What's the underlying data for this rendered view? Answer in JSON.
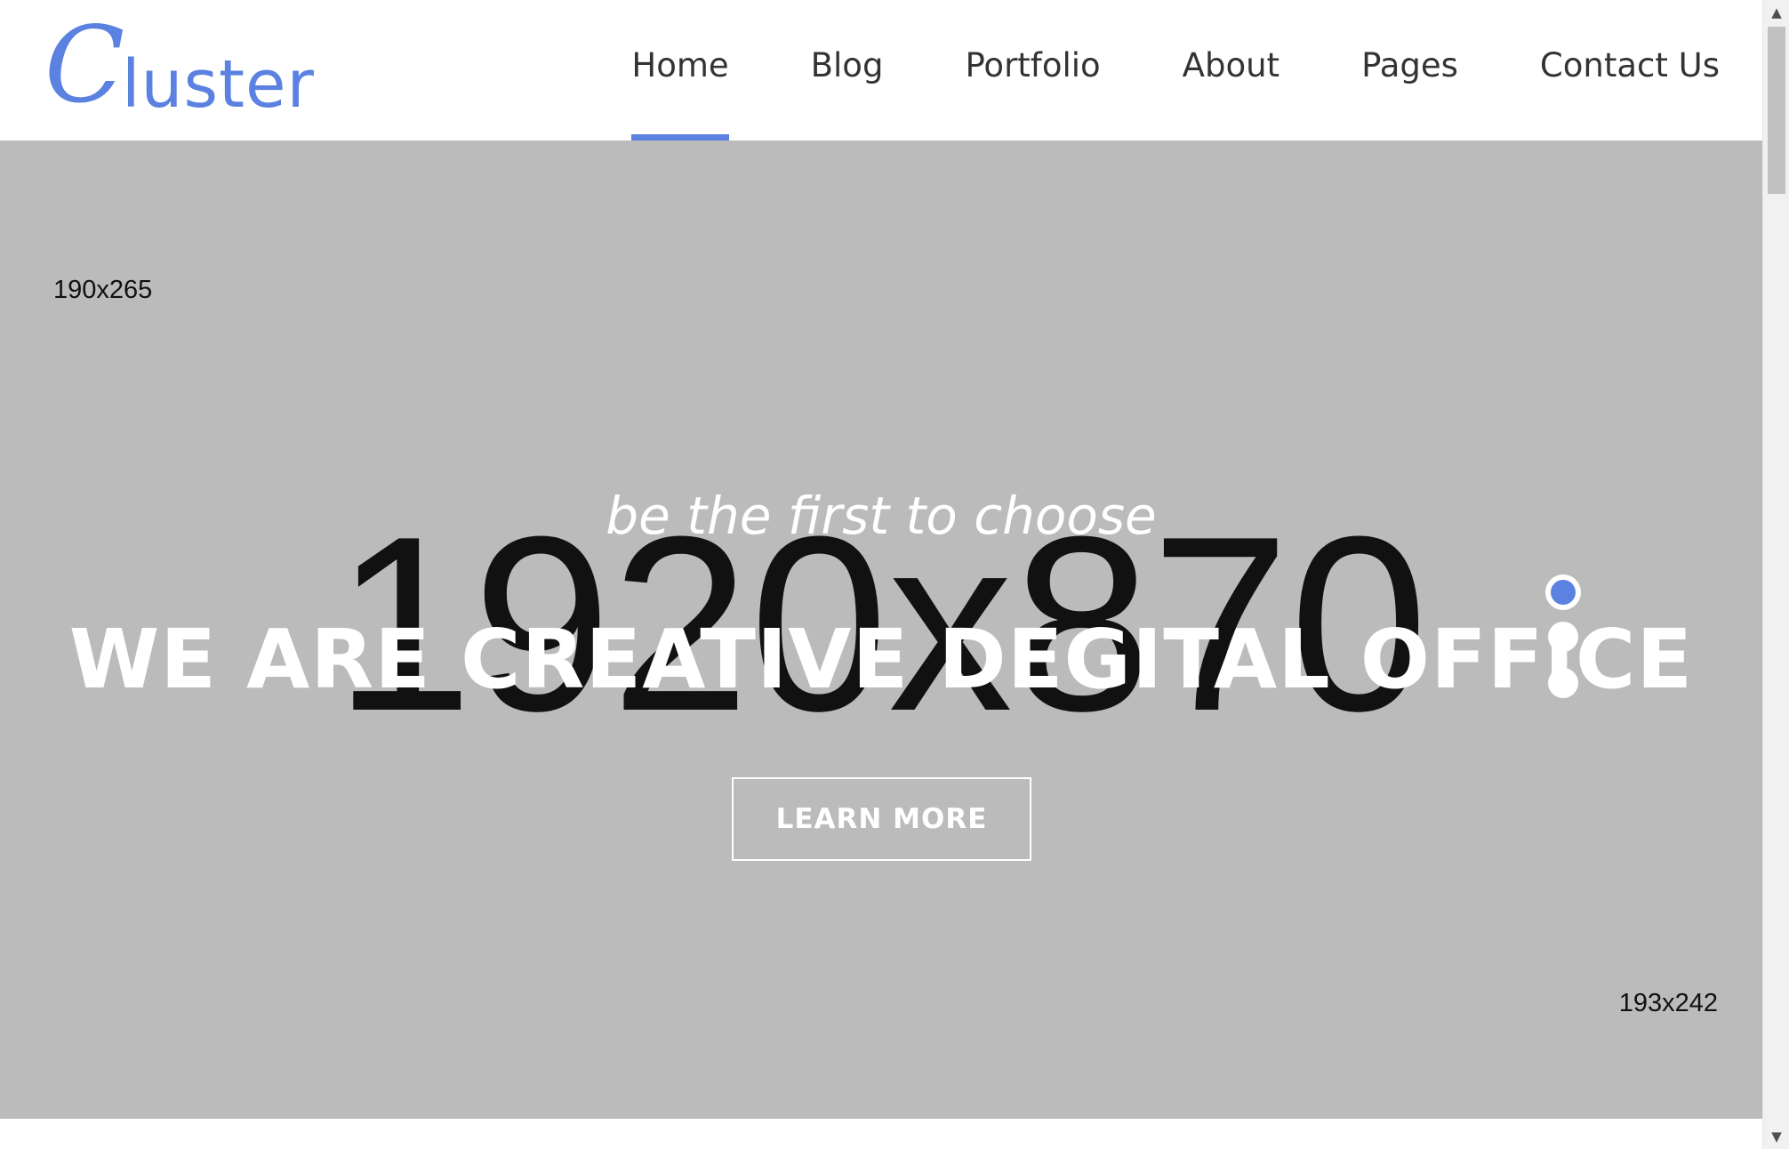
{
  "brand": {
    "logo_initial": "C",
    "logo_rest": "luster",
    "color": "#5b82e0"
  },
  "nav": {
    "items": [
      {
        "label": "Home",
        "active": true
      },
      {
        "label": "Blog",
        "active": false
      },
      {
        "label": "Portfolio",
        "active": false
      },
      {
        "label": "About",
        "active": false
      },
      {
        "label": "Pages",
        "active": false
      },
      {
        "label": "Contact Us",
        "active": false
      }
    ]
  },
  "hero": {
    "placeholder_top_left": "190x265",
    "placeholder_main": "1920x870",
    "placeholder_bottom_right": "193x242",
    "subtitle": "be the first to choose",
    "title": "WE ARE CREATIVE DEGITAL OFFICE",
    "button_label": "LEARN MORE",
    "background_color": "#bbbbbb",
    "slider": {
      "count": 3,
      "active_index": 0
    }
  },
  "scrollbar": {
    "up_icon": "▲",
    "down_icon": "▼"
  }
}
